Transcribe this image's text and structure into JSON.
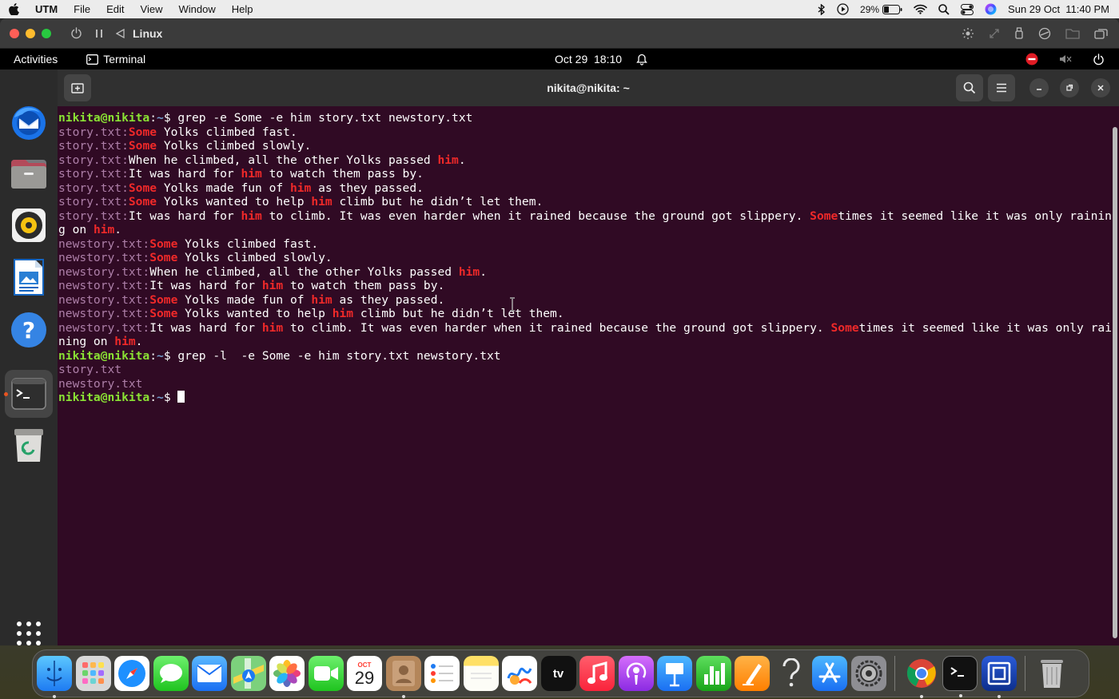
{
  "mac_menubar": {
    "app_name": "UTM",
    "menus": [
      "File",
      "Edit",
      "View",
      "Window",
      "Help"
    ],
    "battery": "29%",
    "datetime": "Sun 29 Oct  11:40 PM"
  },
  "utm": {
    "title": "Linux"
  },
  "gnome": {
    "activities": "Activities",
    "app_name": "Terminal",
    "clock": "Oct 29  18:10"
  },
  "terminal": {
    "title": "nikita@nikita: ~",
    "lines": [
      [
        {
          "t": "nikita@nikita",
          "c": "prompt"
        },
        {
          "t": ":",
          "c": ""
        },
        {
          "t": "~",
          "c": "tilde"
        },
        {
          "t": "$ grep -e Some -e him story.txt newstory.txt",
          "c": ""
        }
      ],
      [
        {
          "t": "story.txt:",
          "c": "fname"
        },
        {
          "t": "Some",
          "c": "match"
        },
        {
          "t": " Yolks climbed fast.",
          "c": ""
        }
      ],
      [
        {
          "t": "story.txt:",
          "c": "fname"
        },
        {
          "t": "Some",
          "c": "match"
        },
        {
          "t": " Yolks climbed slowly.",
          "c": ""
        }
      ],
      [
        {
          "t": "story.txt:",
          "c": "fname"
        },
        {
          "t": "When he climbed, all the other Yolks passed ",
          "c": ""
        },
        {
          "t": "him",
          "c": "match"
        },
        {
          "t": ".",
          "c": ""
        }
      ],
      [
        {
          "t": "story.txt:",
          "c": "fname"
        },
        {
          "t": "It was hard for ",
          "c": ""
        },
        {
          "t": "him",
          "c": "match"
        },
        {
          "t": " to watch them pass by.",
          "c": ""
        }
      ],
      [
        {
          "t": "story.txt:",
          "c": "fname"
        },
        {
          "t": "Some",
          "c": "match"
        },
        {
          "t": " Yolks made fun of ",
          "c": ""
        },
        {
          "t": "him",
          "c": "match"
        },
        {
          "t": " as they passed.",
          "c": ""
        }
      ],
      [
        {
          "t": "story.txt:",
          "c": "fname"
        },
        {
          "t": "Some",
          "c": "match"
        },
        {
          "t": " Yolks wanted to help ",
          "c": ""
        },
        {
          "t": "him",
          "c": "match"
        },
        {
          "t": " climb but he didn’t let them.",
          "c": ""
        }
      ],
      [
        {
          "t": "story.txt:",
          "c": "fname"
        },
        {
          "t": "It was hard for ",
          "c": ""
        },
        {
          "t": "him",
          "c": "match"
        },
        {
          "t": " to climb. It was even harder when it rained because the ground got slippery. ",
          "c": ""
        },
        {
          "t": "Some",
          "c": "match"
        },
        {
          "t": "times it seemed like it was only rainin",
          "c": ""
        }
      ],
      [
        {
          "t": "g on ",
          "c": ""
        },
        {
          "t": "him",
          "c": "match"
        },
        {
          "t": ".",
          "c": ""
        }
      ],
      [
        {
          "t": "newstory.txt:",
          "c": "fname"
        },
        {
          "t": "Some",
          "c": "match"
        },
        {
          "t": " Yolks climbed fast.",
          "c": ""
        }
      ],
      [
        {
          "t": "newstory.txt:",
          "c": "fname"
        },
        {
          "t": "Some",
          "c": "match"
        },
        {
          "t": " Yolks climbed slowly.",
          "c": ""
        }
      ],
      [
        {
          "t": "newstory.txt:",
          "c": "fname"
        },
        {
          "t": "When he climbed, all the other Yolks passed ",
          "c": ""
        },
        {
          "t": "him",
          "c": "match"
        },
        {
          "t": ".",
          "c": ""
        }
      ],
      [
        {
          "t": "newstory.txt:",
          "c": "fname"
        },
        {
          "t": "It was hard for ",
          "c": ""
        },
        {
          "t": "him",
          "c": "match"
        },
        {
          "t": " to watch them pass by.",
          "c": ""
        }
      ],
      [
        {
          "t": "newstory.txt:",
          "c": "fname"
        },
        {
          "t": "Some",
          "c": "match"
        },
        {
          "t": " Yolks made fun of ",
          "c": ""
        },
        {
          "t": "him",
          "c": "match"
        },
        {
          "t": " as they passed.",
          "c": ""
        }
      ],
      [
        {
          "t": "newstory.txt:",
          "c": "fname"
        },
        {
          "t": "Some",
          "c": "match"
        },
        {
          "t": " Yolks wanted to help ",
          "c": ""
        },
        {
          "t": "him",
          "c": "match"
        },
        {
          "t": " climb but he didn’t let them.",
          "c": ""
        }
      ],
      [
        {
          "t": "newstory.txt:",
          "c": "fname"
        },
        {
          "t": "It was hard for ",
          "c": ""
        },
        {
          "t": "him",
          "c": "match"
        },
        {
          "t": " to climb. It was even harder when it rained because the ground got slippery. ",
          "c": ""
        },
        {
          "t": "Some",
          "c": "match"
        },
        {
          "t": "times it seemed like it was only rai",
          "c": ""
        }
      ],
      [
        {
          "t": "ning on ",
          "c": ""
        },
        {
          "t": "him",
          "c": "match"
        },
        {
          "t": ".",
          "c": ""
        }
      ],
      [
        {
          "t": "nikita@nikita",
          "c": "prompt"
        },
        {
          "t": ":",
          "c": ""
        },
        {
          "t": "~",
          "c": "tilde"
        },
        {
          "t": "$ grep -l  -e Some -e him story.txt newstory.txt",
          "c": ""
        }
      ],
      [
        {
          "t": "story.txt",
          "c": "fname"
        }
      ],
      [
        {
          "t": "newstory.txt",
          "c": "fname"
        }
      ],
      [
        {
          "t": "nikita@nikita",
          "c": "prompt"
        },
        {
          "t": ":",
          "c": ""
        },
        {
          "t": "~",
          "c": "tilde"
        },
        {
          "t": "$ ",
          "c": ""
        }
      ]
    ]
  },
  "calendar_icon": {
    "month": "OCT",
    "day": "29"
  },
  "colors": {
    "terminal_bg": "#300a24",
    "prompt_green": "#8ae234",
    "path_blue": "#729fcf",
    "filename_purple": "#ad7fa8",
    "match_red": "#ef2929"
  }
}
